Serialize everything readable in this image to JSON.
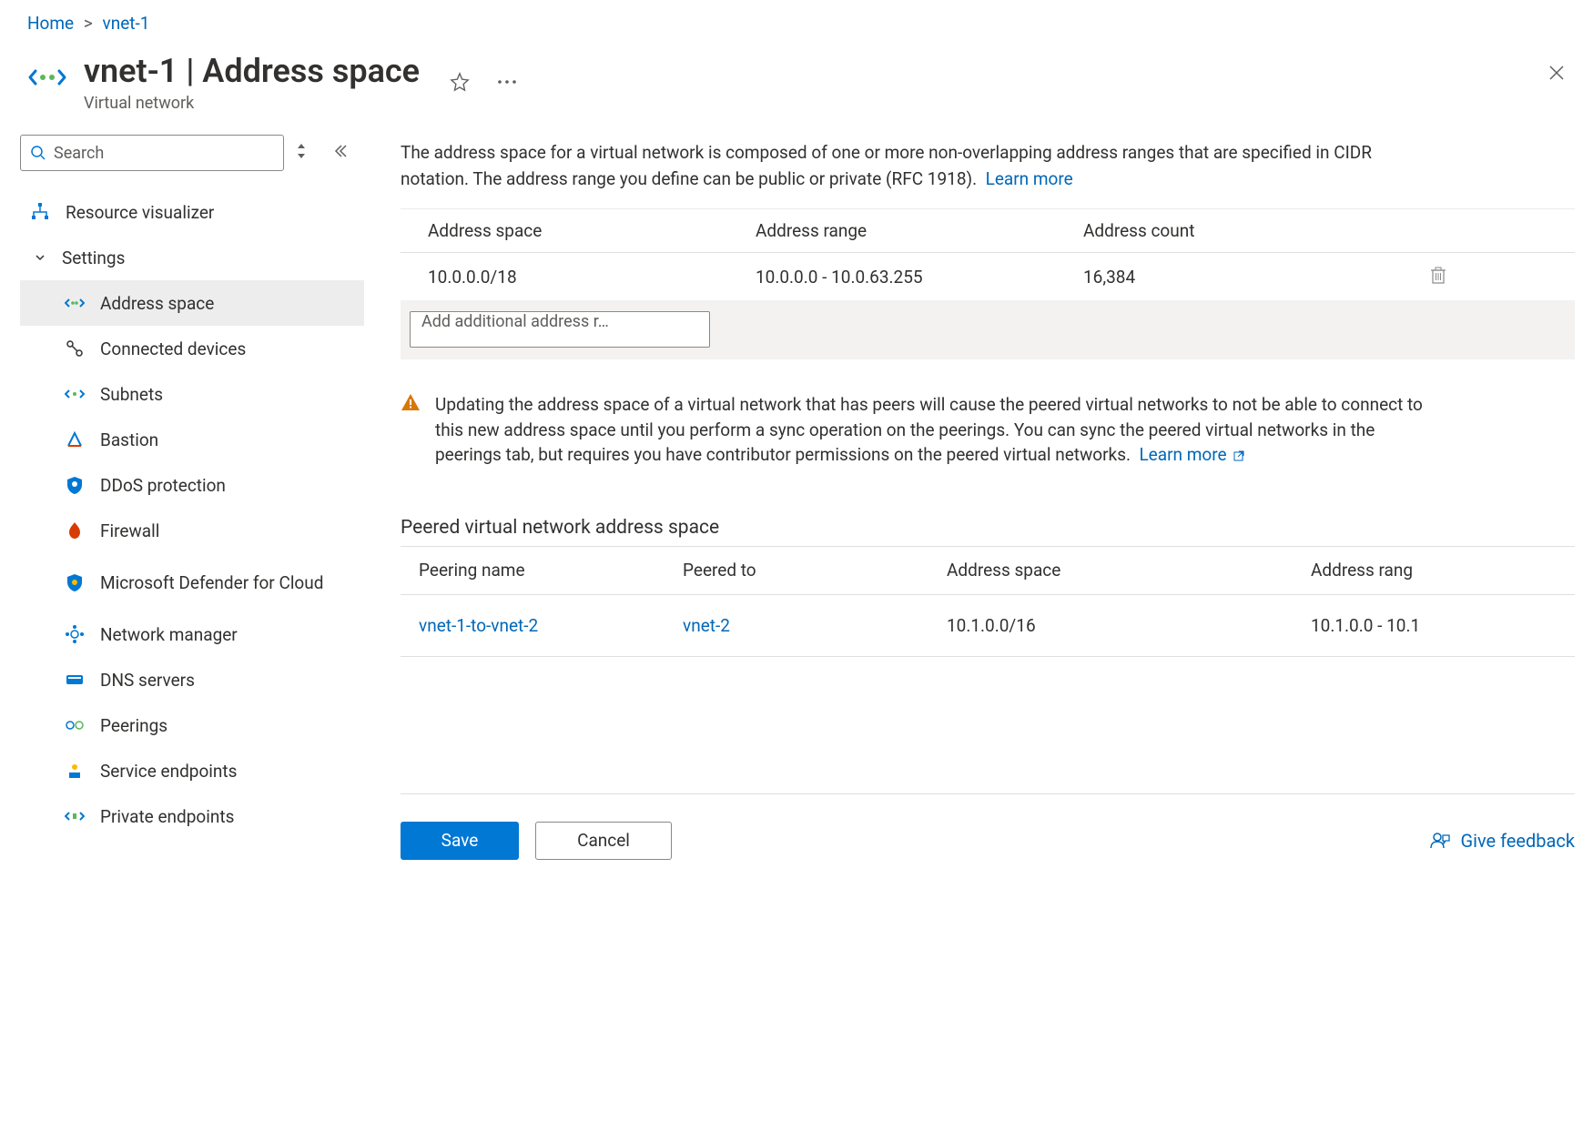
{
  "breadcrumb": {
    "home": "Home",
    "resource": "vnet-1"
  },
  "header": {
    "title": "vnet-1 | Address space",
    "subtitle": "Virtual network"
  },
  "sidebar": {
    "search_placeholder": "Search",
    "top_item": {
      "label": "Resource visualizer"
    },
    "section": "Settings",
    "items": [
      {
        "label": "Address space",
        "selected": true
      },
      {
        "label": "Connected devices"
      },
      {
        "label": "Subnets"
      },
      {
        "label": "Bastion"
      },
      {
        "label": "DDoS protection"
      },
      {
        "label": "Firewall"
      },
      {
        "label": "Microsoft Defender for Cloud"
      },
      {
        "label": "Network manager"
      },
      {
        "label": "DNS servers"
      },
      {
        "label": "Peerings"
      },
      {
        "label": "Service endpoints"
      },
      {
        "label": "Private endpoints"
      }
    ]
  },
  "main": {
    "description": "The address space for a virtual network is composed of one or more non-overlapping address ranges that are specified in CIDR notation. The address range you define can be public or private (RFC 1918).",
    "learn_more": "Learn more",
    "columns": {
      "space": "Address space",
      "range": "Address range",
      "count": "Address count"
    },
    "rows": [
      {
        "space": "10.0.0.0/18",
        "range": "10.0.0.0 - 10.0.63.255",
        "count": "16,384"
      }
    ],
    "add_placeholder": "Add additional address r…",
    "warning": "Updating the address space of a virtual network that has peers will cause the peered virtual networks to not be able to connect to this new address space until you perform a sync operation on the peerings. You can sync the peered virtual networks in the peerings tab, but requires you have contributor permissions on the peered virtual networks.",
    "warning_learn_more": "Learn more",
    "peer_section_title": "Peered virtual network address space",
    "peer_columns": {
      "name": "Peering name",
      "to": "Peered to",
      "space": "Address space",
      "range": "Address rang"
    },
    "peer_rows": [
      {
        "name": "vnet-1-to-vnet-2",
        "to": "vnet-2",
        "space": "10.1.0.0/16",
        "range": "10.1.0.0 - 10.1"
      }
    ]
  },
  "footer": {
    "save": "Save",
    "cancel": "Cancel",
    "feedback": "Give feedback"
  }
}
